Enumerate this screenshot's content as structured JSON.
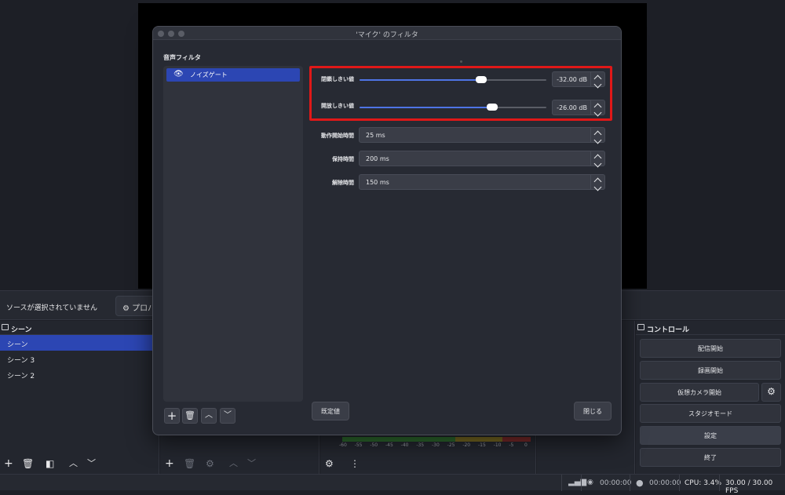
{
  "modal": {
    "title": "'マイク' のフィルタ",
    "section_label": "音声フィルタ",
    "filters": [
      {
        "label": "ノイズゲート"
      }
    ],
    "params": [
      {
        "label": "閉鎖しきい値",
        "value": "-32.00 dB",
        "slider_fraction": 0.65
      },
      {
        "label": "開放しきい値",
        "value": "-26.00 dB",
        "slider_fraction": 0.71
      },
      {
        "label": "動作開始時間",
        "value": "25 ms"
      },
      {
        "label": "保持時間",
        "value": "200 ms"
      },
      {
        "label": "解除時間",
        "value": "150 ms"
      }
    ],
    "defaults_button": "既定値",
    "close_button": "閉じる"
  },
  "main": {
    "no_source": "ソースが選択されていません",
    "properties_button": "プロパ",
    "scenes_title": "シーン",
    "scenes": [
      "シーン",
      "シーン 3",
      "シーン 2"
    ],
    "controls_title": "コントロール",
    "controls": [
      "配信開始",
      "録画開始",
      "仮想カメラ開始",
      "スタジオモード",
      "設定",
      "終了"
    ],
    "meter_ticks": [
      "-60",
      "-55",
      "-50",
      "-45",
      "-40",
      "-35",
      "-30",
      "-25",
      "-20",
      "-15",
      "-10",
      "-5",
      "0"
    ]
  },
  "status": {
    "stream_time": "00:00:00",
    "rec_time": "00:00:00",
    "cpu": "CPU: 3.4%",
    "fps": "30.00 / 30.00 FPS"
  }
}
